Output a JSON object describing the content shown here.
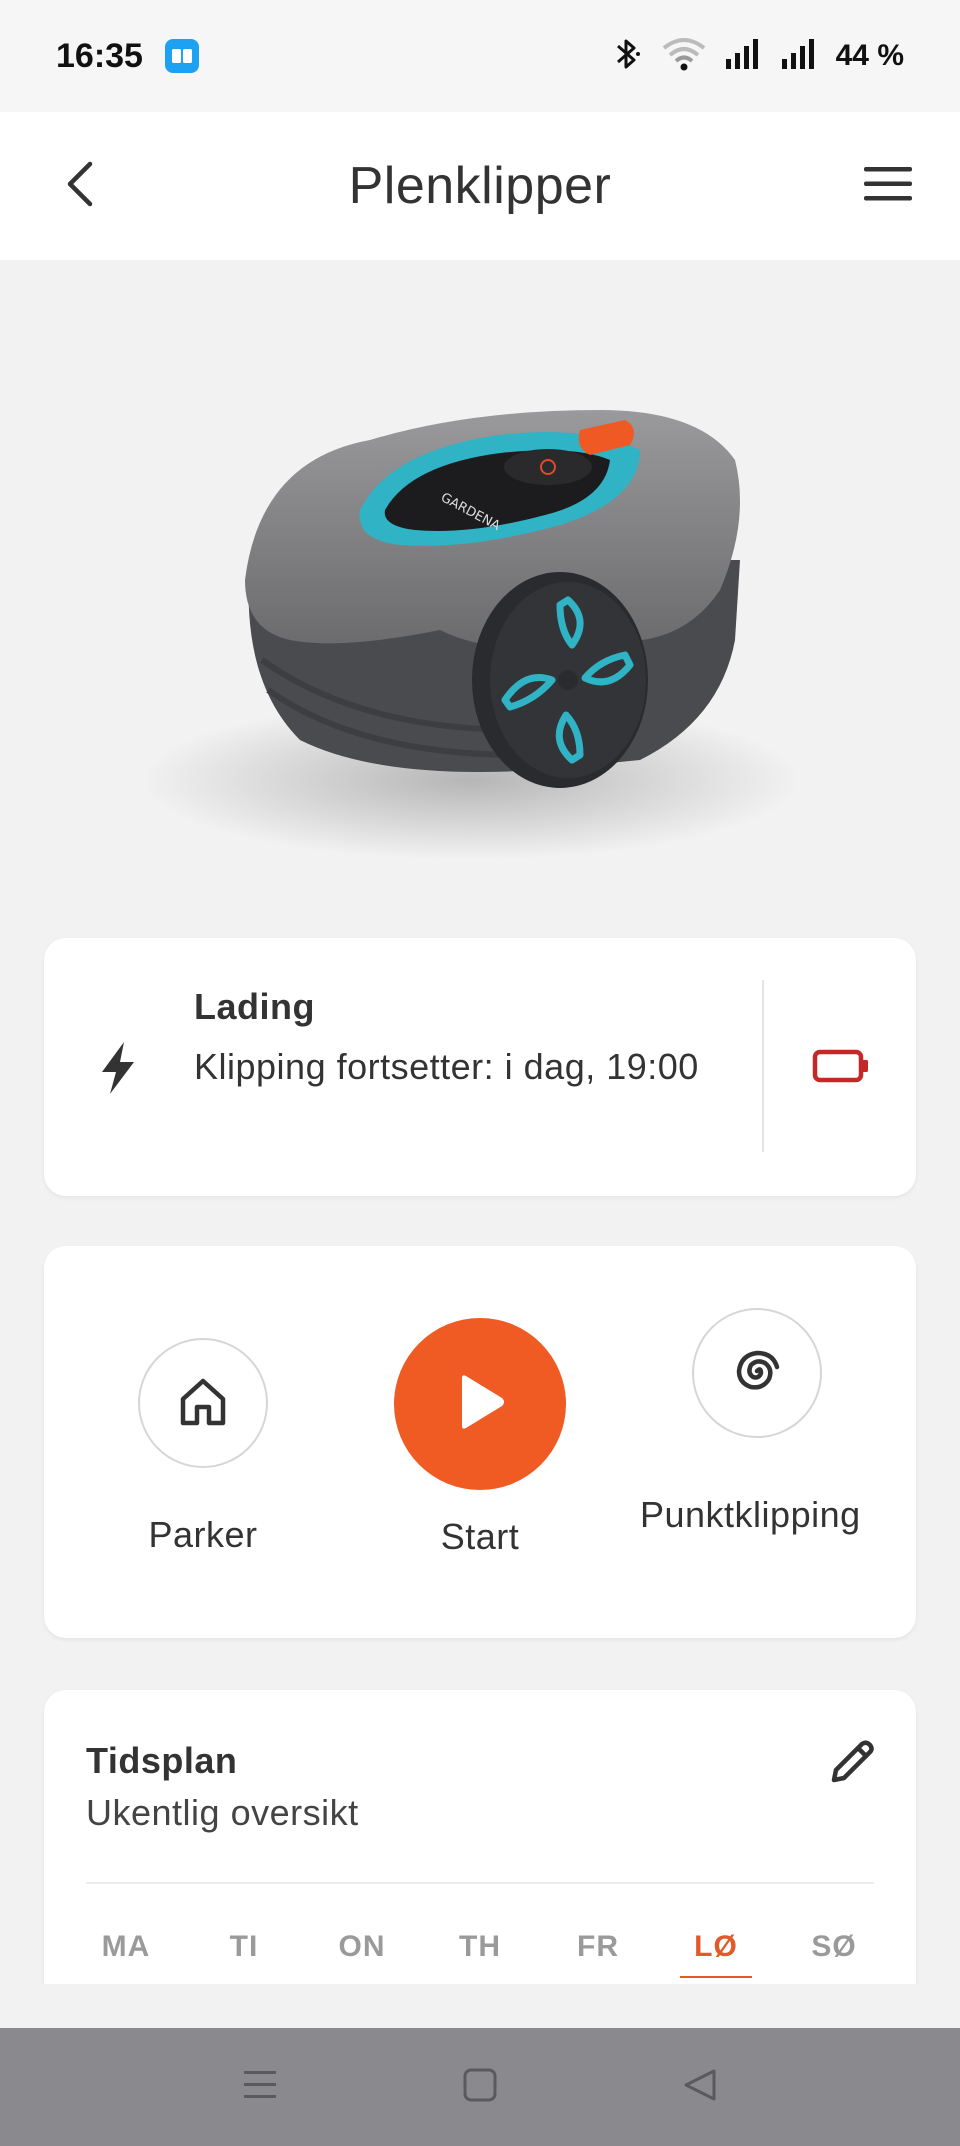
{
  "status_bar": {
    "time": "16:35",
    "battery_percent": "44 %",
    "icons": [
      "app-icon",
      "bluetooth-icon",
      "wifi-icon",
      "signal-icon",
      "signal-icon"
    ]
  },
  "header": {
    "title": "Plenklipper",
    "back_icon": "chevron-left-icon",
    "menu_icon": "hamburger-menu-icon"
  },
  "hero": {
    "image": "robotic-lawn-mower",
    "brand_text": "GARDENA"
  },
  "status_card": {
    "title": "Lading",
    "subtitle": "Klipping fortsetter: i dag, 19:00",
    "status_icon": "lightning-bolt-icon",
    "battery_icon": "battery-low-icon",
    "battery_color": "#c62828"
  },
  "actions": {
    "park_label": "Parker",
    "start_label": "Start",
    "spot_label": "Punktklipping",
    "start_color": "#f05a23"
  },
  "schedule": {
    "title": "Tidsplan",
    "subtitle": "Ukentlig oversikt",
    "edit_icon": "pencil-icon",
    "days": [
      {
        "label": "MA",
        "active": false
      },
      {
        "label": "TI",
        "active": false
      },
      {
        "label": "ON",
        "active": false
      },
      {
        "label": "TH",
        "active": false
      },
      {
        "label": "FR",
        "active": false
      },
      {
        "label": "LØ",
        "active": true
      },
      {
        "label": "SØ",
        "active": false
      }
    ],
    "accent_color": "#e2592a"
  },
  "nav_bar": {
    "icons": [
      "recents-icon",
      "home-icon",
      "back-icon"
    ]
  }
}
